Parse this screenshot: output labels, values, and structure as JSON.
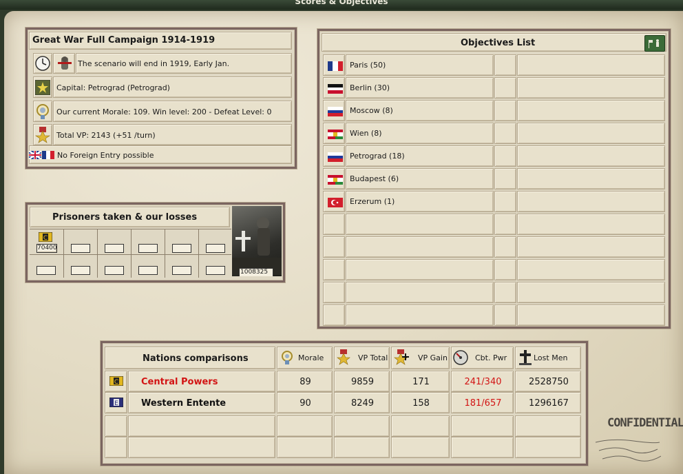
{
  "window": {
    "title": "Scores & Objectives"
  },
  "scenario": {
    "title": "Great War Full Campaign 1914-1919",
    "end_text": "The scenario will end in 1919, Early Jan.",
    "capital_text": "Capital: Petrograd (Petrograd)",
    "morale_text": "Our current Morale: 109. Win level: 200 - Defeat Level: 0",
    "vp_text": "Total VP: 2143 (+51 /turn)",
    "foreign_entry_text": "No Foreign Entry possible"
  },
  "prisoners": {
    "title": "Prisoners taken & our losses",
    "taken_value": "70400",
    "losses_value": "1008325"
  },
  "objectives": {
    "title": "Objectives List",
    "items": [
      {
        "name": "Paris (50)",
        "flag": "france"
      },
      {
        "name": "Berlin (30)",
        "flag": "germany"
      },
      {
        "name": "Moscow (8)",
        "flag": "russia"
      },
      {
        "name": "Wien (8)",
        "flag": "austria-hungary"
      },
      {
        "name": "Petrograd (18)",
        "flag": "russia"
      },
      {
        "name": "Budapest (6)",
        "flag": "austria-hungary"
      },
      {
        "name": "Erzerum (1)",
        "flag": "ottoman"
      }
    ]
  },
  "nations": {
    "title": "Nations comparisons",
    "columns": [
      "Morale",
      "VP Total",
      "VP Gain",
      "Cbt. Pwr",
      "Lost Men"
    ],
    "rows": [
      {
        "name": "Central Powers",
        "morale": "89",
        "vp_total": "9859",
        "vp_gain": "171",
        "cbt_pwr": "241/340",
        "lost_men": "2528750",
        "highlight": "#d21414"
      },
      {
        "name": "Western Entente",
        "morale": "90",
        "vp_total": "8249",
        "vp_gain": "158",
        "cbt_pwr": "181/657",
        "lost_men": "1296167",
        "highlight": "#111111"
      }
    ]
  },
  "stamp": {
    "text": "CONFIDENTIAL"
  },
  "colors": {
    "panel_border": "#7b6560",
    "paper": "#e3dbc4",
    "alert_red": "#d21414"
  }
}
